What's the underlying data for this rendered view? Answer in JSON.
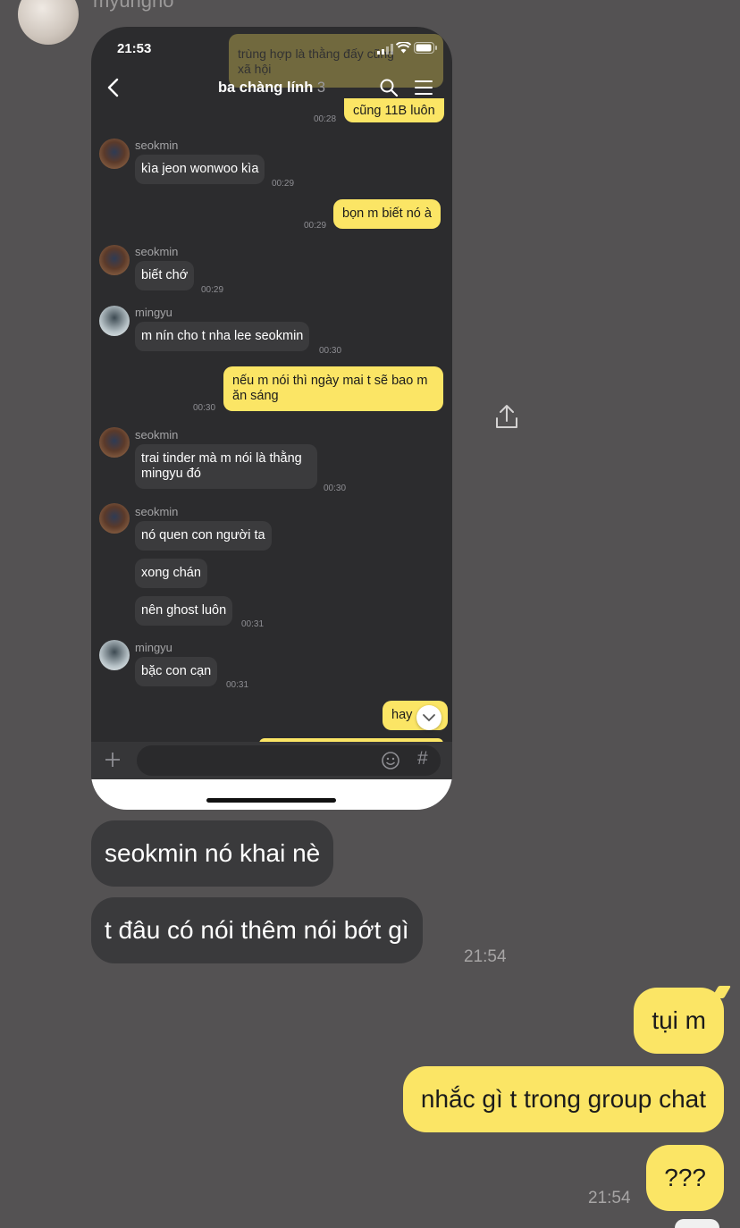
{
  "outer": {
    "sender_name": "myungho",
    "received_messages": [
      "seokmin nó khai nè",
      "t đâu có nói thêm nói bớt gì"
    ],
    "received_time": "21:54",
    "sent_messages": [
      "tụi m",
      "nhắc gì t trong group chat",
      "???"
    ],
    "sent_time": "21:54"
  },
  "screenshot": {
    "status_time": "21:53",
    "chat_title": "ba chàng lính",
    "member_count": "3",
    "faded_messages": [
      "trùng hợp là thằng đấy cũng",
      "xã hội",
      "cũng 11B luôn"
    ],
    "faded_time": "00:28",
    "messages": [
      {
        "side": "left",
        "sender": "seokmin",
        "avatar": "seokmin",
        "bubbles": [
          "kìa jeon wonwoo kìa"
        ],
        "time": "00:29"
      },
      {
        "side": "right",
        "bubbles": [
          "bọn m biết nó à"
        ],
        "time": "00:29"
      },
      {
        "side": "left",
        "sender": "seokmin",
        "avatar": "seokmin",
        "bubbles": [
          "biết chớ"
        ],
        "time": "00:29"
      },
      {
        "side": "left",
        "sender": "mingyu",
        "avatar": "mingyu",
        "bubbles": [
          "m nín cho t nha lee seokmin"
        ],
        "time": "00:30"
      },
      {
        "side": "right",
        "bubbles": [
          "nếu m nói thì ngày mai t sẽ bao m ăn sáng"
        ],
        "time": "00:30"
      },
      {
        "side": "left",
        "sender": "seokmin",
        "avatar": "seokmin",
        "bubbles": [
          "trai tinder mà m nói là thằng mingyu đó"
        ],
        "time": "00:30"
      },
      {
        "side": "left",
        "sender": "seokmin",
        "avatar": "seokmin",
        "bubbles": [
          "nó quen con người ta",
          "xong chán",
          "nên ghost luôn"
        ],
        "time": "00:31"
      },
      {
        "side": "left",
        "sender": "mingyu",
        "avatar": "mingyu",
        "bubbles": [
          "bặc con cạn"
        ],
        "time": "00:31"
      },
      {
        "side": "right",
        "bubbles": [
          "hay"
        ],
        "time": ""
      }
    ],
    "input_placeholder": "",
    "hash_label": "#"
  },
  "colors": {
    "page_bg": "#545253",
    "screenshot_bg": "#2c2c2e",
    "yellow_bubble": "#fbe565",
    "gray_bubble": "#3a3a3c"
  },
  "icons": [
    "back-arrow-icon",
    "search-icon",
    "menu-icon",
    "share-icon",
    "plus-icon",
    "emoji-icon",
    "hash-icon",
    "chevron-down-icon"
  ]
}
